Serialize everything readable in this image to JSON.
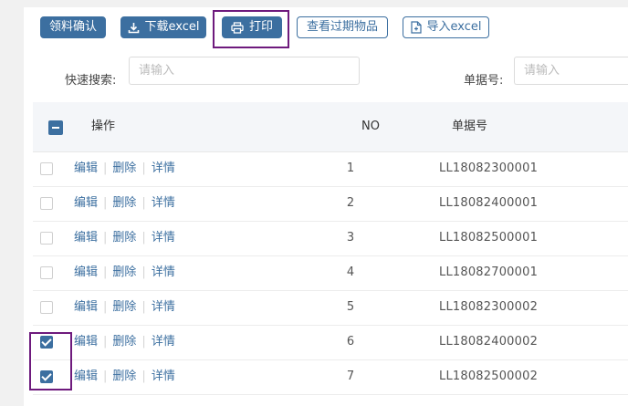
{
  "toolbar": {
    "confirm_label": "领料确认",
    "download_label": "下载excel",
    "print_label": "打印",
    "expired_label": "查看过期物品",
    "import_label": "导入excel"
  },
  "filters": {
    "quick_search_label": "快速搜索:",
    "quick_search_placeholder": "请输入",
    "doc_no_label": "单据号:",
    "doc_no_placeholder": "请输入"
  },
  "table": {
    "headers": {
      "ops": "操作",
      "no": "NO",
      "doc_no": "单据号"
    },
    "actions": {
      "edit": "编辑",
      "delete": "删除",
      "detail": "详情",
      "separator": "|"
    },
    "rows": [
      {
        "no": "1",
        "code": "LL18082300001",
        "checked": false
      },
      {
        "no": "2",
        "code": "LL18082400001",
        "checked": false
      },
      {
        "no": "3",
        "code": "LL18082500001",
        "checked": false
      },
      {
        "no": "4",
        "code": "LL18082700001",
        "checked": false
      },
      {
        "no": "5",
        "code": "LL18082300002",
        "checked": false
      },
      {
        "no": "6",
        "code": "LL18082400002",
        "checked": true
      },
      {
        "no": "7",
        "code": "LL18082500002",
        "checked": true
      }
    ]
  },
  "colors": {
    "primary": "#3c6fa0",
    "highlight": "#6e1a7d"
  }
}
